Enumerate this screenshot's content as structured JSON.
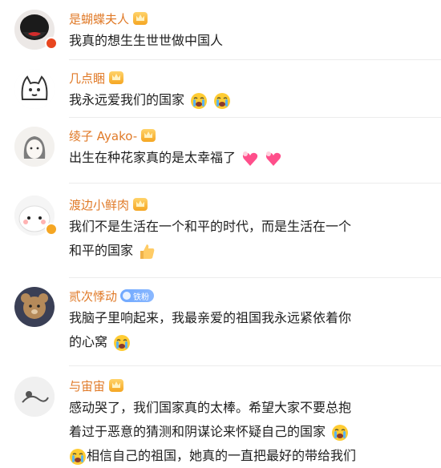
{
  "comments": [
    {
      "username": "是蝴蝶夫人",
      "text": "我真的想生生世世做中国人",
      "emojis": []
    },
    {
      "username": "几点睏",
      "text": "我永远爱我们的国家",
      "emojis": [
        "crying-face",
        "crying-face"
      ]
    },
    {
      "username": "绫子 Ayako-",
      "text": "出生在种花家真的是太幸福了",
      "emojis": [
        "heart-with-bow",
        "heart-with-bow"
      ]
    },
    {
      "username": "渡边小鲜肉",
      "text_line1": "我们不是生活在一个和平的时代，而是生活在一个",
      "text_line2": "和平的国家",
      "emojis": [
        "thumbs-up"
      ]
    },
    {
      "username": "贰次悸动",
      "badge": "铁粉",
      "text_line1": "我脑子里响起来，我最亲爱的祖国我永远紧依着你",
      "text_line2": "的心窝",
      "emojis": [
        "crying-face"
      ]
    },
    {
      "username": "与宙宙",
      "text_line1": "感动哭了，我们国家真的太棒。希望大家不要总抱",
      "text_line2": "着过于恶意的猜测和阴谋论来怀疑自己的国家",
      "text_line3": "相信自己的祖国，她真的一直把最好的带给我们",
      "emojis": [
        "crying-face",
        "crying-face"
      ]
    }
  ],
  "colors": {
    "username": "#e07a28",
    "text": "#1e1e1e",
    "divider": "#ececec"
  }
}
